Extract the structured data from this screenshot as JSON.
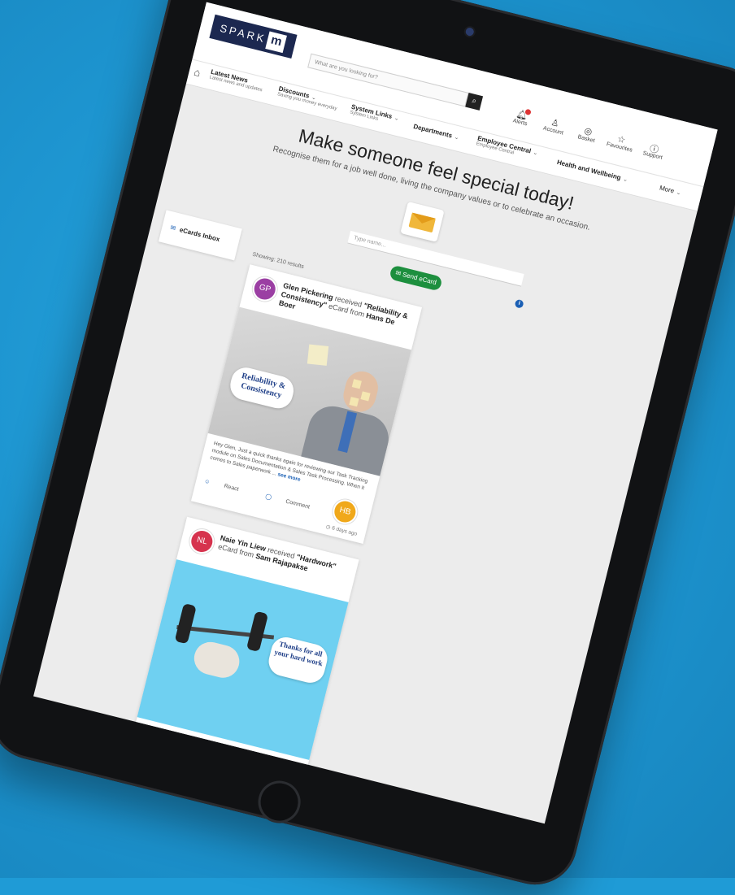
{
  "header": {
    "logo_text": "SPARK",
    "logo_mark": "m",
    "search_placeholder": "What are you looking for?",
    "utilities": [
      {
        "label": "Alerts",
        "icon": "bell-icon"
      },
      {
        "label": "Account",
        "icon": "person-icon"
      },
      {
        "label": "Basket",
        "icon": "basket-icon"
      },
      {
        "label": "Favourites",
        "icon": "star-icon"
      },
      {
        "label": "Support",
        "icon": "help-icon"
      }
    ]
  },
  "nav": {
    "items": [
      {
        "label": "Latest News",
        "sub": "Latest news and updates"
      },
      {
        "label": "Discounts",
        "sub": "Saving you money everyday"
      },
      {
        "label": "System Links",
        "sub": "System Links"
      },
      {
        "label": "Departments",
        "sub": ""
      },
      {
        "label": "Employee Central",
        "sub": "Employee Central"
      },
      {
        "label": "Health and Wellbeing",
        "sub": ""
      },
      {
        "label": "More",
        "sub": ""
      }
    ]
  },
  "main": {
    "headline": "Make someone feel special today!",
    "subline": "Recognise them for a job well done, living the company values or to celebrate an occasion.",
    "name_placeholder": "Type name...",
    "send_label": "Send eCard",
    "inbox_label": "eCards Inbox",
    "showing": "Showing: 210 results"
  },
  "cards": [
    {
      "avatar": "GP",
      "avatar_color": "#9b3fa3",
      "recipient": "Glen Pickering",
      "received": "received",
      "ecard": "\"Reliability & Consistency\"",
      "ecard_word": "eCard",
      "from_word": "from",
      "sender": "Hans De Boer",
      "bubble": "Reliability & Consistency",
      "message": "Hey Glen, Just a quick thanks again for reviewing our Task Tracking module on Sales Documentation & Sales Task Processing. When it comes to Sales paperwork ...",
      "see_more": "see more",
      "reply_avatar": "HB",
      "action_react": "React",
      "action_comment": "Comment",
      "time": "6 days ago"
    },
    {
      "avatar": "NL",
      "avatar_color": "#d6334e",
      "recipient": "Naie Yin Liew",
      "received": "received",
      "ecard": "\"Hardwork\"",
      "ecard_word": "eCard from",
      "sender": "Sam Rajapakse",
      "bubble": "Thanks for all your hard work"
    }
  ]
}
